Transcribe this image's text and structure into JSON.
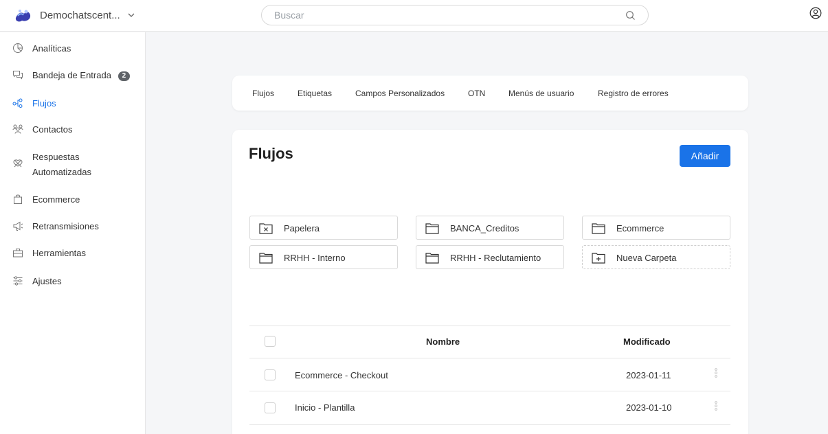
{
  "workspace": {
    "name": "Demochatscent...",
    "logo": "brand-logo",
    "dropdown_icon": "chevron-down-icon"
  },
  "search": {
    "placeholder": "Buscar",
    "value": ""
  },
  "sidebar": {
    "items": [
      {
        "label": "Analíticas",
        "icon": "analytics-icon"
      },
      {
        "label": "Bandeja de Entrada",
        "icon": "inbox-icon",
        "badge": "2"
      },
      {
        "label": "Flujos",
        "icon": "flows-icon",
        "active": true
      },
      {
        "label": "Contactos",
        "icon": "contacts-icon"
      },
      {
        "label": "Respuestas",
        "label2": "Automatizadas",
        "icon": "auto-replies-icon"
      },
      {
        "label": "Ecommerce",
        "icon": "shopping-bag-icon"
      },
      {
        "label": "Retransmisiones",
        "icon": "broadcast-icon"
      },
      {
        "label": "Herramientas",
        "icon": "toolbox-icon"
      },
      {
        "label": "Ajustes",
        "icon": "settings-icon"
      }
    ]
  },
  "tabs": [
    "Flujos",
    "Etiquetas",
    "Campos Personalizados",
    "OTN",
    "Menús de usuario",
    "Registro de errores"
  ],
  "main": {
    "title": "Flujos",
    "add_label": "Añadir"
  },
  "folders": [
    {
      "label": "Papelera",
      "icon": "trash-folder-icon"
    },
    {
      "label": "BANCA_Creditos",
      "icon": "folder-icon"
    },
    {
      "label": "Ecommerce",
      "icon": "folder-icon"
    },
    {
      "label": "RRHH - Interno",
      "icon": "folder-icon"
    },
    {
      "label": "RRHH - Reclutamiento",
      "icon": "folder-icon"
    },
    {
      "label": "Nueva Carpeta",
      "icon": "new-folder-icon"
    }
  ],
  "table": {
    "headers": {
      "name": "Nombre",
      "modified": "Modificado"
    },
    "rows": [
      {
        "name": "Ecommerce - Checkout",
        "modified": "2023-01-11"
      },
      {
        "name": "Inicio - Plantilla",
        "modified": "2023-01-10"
      }
    ]
  },
  "colors": {
    "accent": "#1a73e8",
    "badge": "#5f6368"
  }
}
